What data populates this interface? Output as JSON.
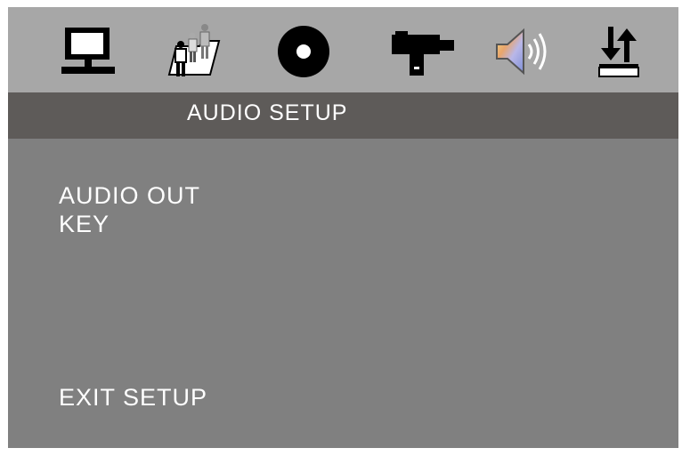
{
  "icons": [
    {
      "name": "monitor-icon",
      "label": "General Setup"
    },
    {
      "name": "family-folder-icon",
      "label": "Parental Setup"
    },
    {
      "name": "disc-icon",
      "label": "Disc Setup"
    },
    {
      "name": "video-connector-icon",
      "label": "Video Setup"
    },
    {
      "name": "speaker-icon",
      "label": "Audio Setup",
      "active": true
    },
    {
      "name": "up-down-arrows-icon",
      "label": "Preference Setup"
    }
  ],
  "title": "AUDIO SETUP",
  "menu": {
    "items": [
      "AUDIO OUT",
      "KEY"
    ],
    "exit": "EXIT SETUP"
  },
  "colors": {
    "icon_bar": "#a7a7a7",
    "title_bar": "#5e5b59",
    "body": "#808080",
    "text": "#ffffff"
  }
}
